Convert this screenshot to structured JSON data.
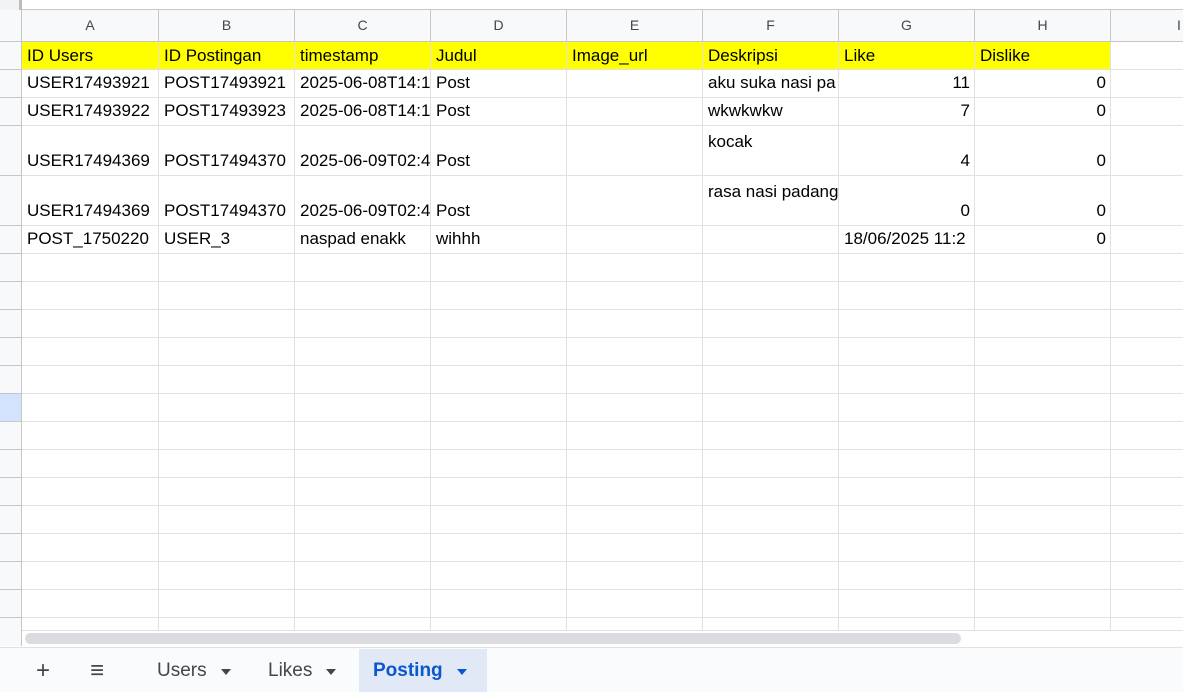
{
  "columns": [
    "A",
    "B",
    "C",
    "D",
    "E",
    "F",
    "G",
    "H",
    "I"
  ],
  "header_row": [
    "ID Users",
    "ID Postingan",
    "timestamp",
    "Judul",
    "Image_url",
    "Deskripsi",
    "Like",
    "Dislike"
  ],
  "rows": [
    {
      "a": "USER17493921",
      "b": "POST17493921",
      "c": "2025-06-08T14:1",
      "d": "Post",
      "e": "",
      "f": "aku suka nasi pa",
      "g": "11",
      "h": "0"
    },
    {
      "a": "USER17493922",
      "b": "POST17493923",
      "c": "2025-06-08T14:1",
      "d": "Post",
      "e": "",
      "f": "wkwkwkw",
      "g": "7",
      "h": "0"
    },
    {
      "a": "USER17494369",
      "b": "POST17494370",
      "c": "2025-06-09T02:4",
      "d": "Post",
      "e": "",
      "f": "kocak",
      "g": "4",
      "h": "0"
    },
    {
      "a": "USER17494369",
      "b": "POST17494370",
      "c": "2025-06-09T02:4",
      "d": "Post",
      "e": "",
      "f": "rasa nasi padang",
      "g": "0",
      "h": "0"
    },
    {
      "a": "POST_1750220",
      "b": "USER_3",
      "c": "naspad enakk",
      "d": "wihhh",
      "e": "",
      "f": "",
      "g": "18/06/2025 11:2",
      "h": "0"
    }
  ],
  "sheet_bar": {
    "add_icon": "+",
    "menu_icon": "≡",
    "tabs": [
      "Users",
      "Likes",
      "Posting"
    ],
    "active_tab": "Posting"
  },
  "colors": {
    "header_fill": "#ffff00",
    "active_tab_text": "#0b57d0",
    "active_tab_bg": "#e1e9f7",
    "selected_row_header": "#d3e3fd"
  }
}
